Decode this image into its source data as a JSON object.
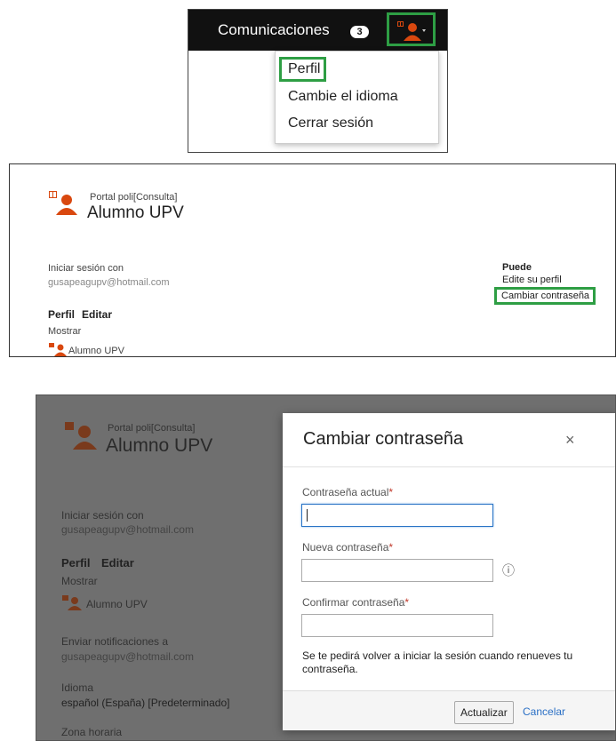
{
  "panel1": {
    "nav_label": "Comunicaciones",
    "badge_count": "3",
    "menu_items": [
      "Perfil",
      "Cambie el idioma",
      "Cerrar sesión"
    ]
  },
  "panel2": {
    "portal": "Portal poli[Consulta]",
    "name": "Alumno UPV",
    "login_label": "Iniciar sesión con",
    "login_value": "gusapeagupv@hotmail.com",
    "profile_label": "Perfil",
    "edit_label": "Editar",
    "show_label": "Mostrar",
    "show_name": "Alumno UPV",
    "can_label": "Puede",
    "edit_profile_link": "Edite su perfil",
    "change_pwd_link": "Cambiar contraseña"
  },
  "panel3": {
    "portal": "Portal poli[Consulta]",
    "name": "Alumno UPV",
    "login_label": "Iniciar sesión con",
    "login_value": "gusapeagupv@hotmail.com",
    "profile_label": "Perfil",
    "edit_label": "Editar",
    "show_label": "Mostrar",
    "show_name": "Alumno UPV",
    "notif_label": "Enviar notificaciones a",
    "notif_value": "gusapeagupv@hotmail.com",
    "lang_label": "Idioma",
    "lang_value": "español (España) [Predeterminado]",
    "tz_label": "Zona horaria",
    "dialog": {
      "title": "Cambiar contraseña",
      "close": "×",
      "current_label": "Contraseña actual",
      "new_label": "Nueva contraseña",
      "confirm_label": "Confirmar contraseña",
      "required_mark": "*",
      "info_icon": "ⓘ",
      "note": "Se te pedirá volver a iniciar la sesión cuando renueves tu contraseña.",
      "update_button": "Actualizar",
      "cancel_link": "Cancelar"
    }
  },
  "colors": {
    "highlight": "#2e9e44",
    "brand_orange": "#d9480f",
    "link": "#2a6fc5"
  }
}
